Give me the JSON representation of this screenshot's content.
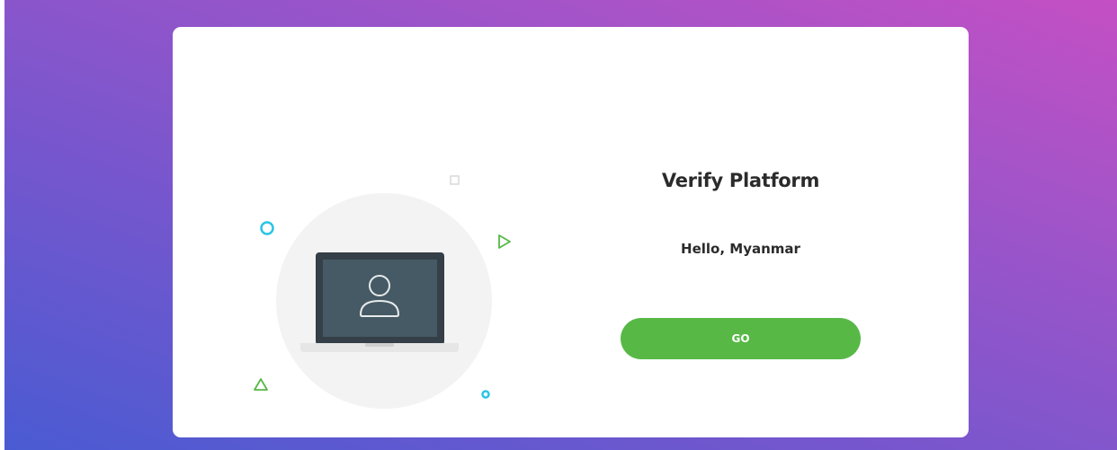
{
  "login": {
    "title": "Verify Platform",
    "greeting": "Hello, Myanmar",
    "go_label": "GO"
  },
  "colors": {
    "gradient_start": "#4a5bd2",
    "gradient_end": "#c44fc4",
    "button": "#57b846",
    "laptop_screen": "#455a64",
    "accent_cyan": "#2bc4e4",
    "accent_green": "#57b846"
  },
  "icons": {
    "illustration": "laptop-user-icon",
    "decorations": [
      "circle-icon",
      "square-icon",
      "triangle-play-icon",
      "triangle-icon",
      "small-circle-icon"
    ]
  }
}
